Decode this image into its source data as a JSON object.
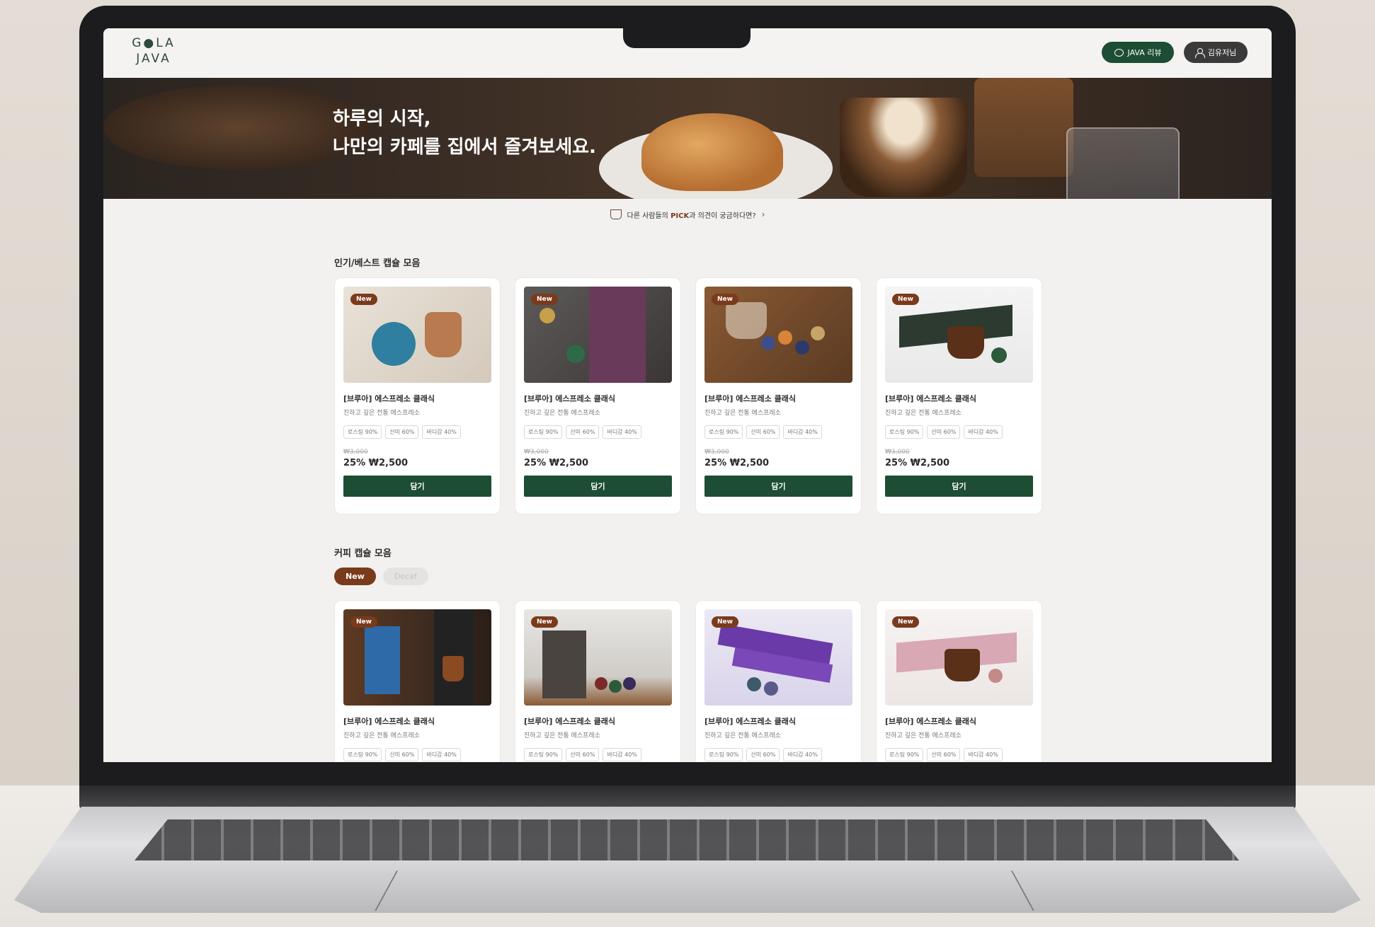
{
  "header": {
    "logo_line1": "G●LA",
    "logo_line2": "JAVA",
    "review_button": "JAVA 리뷰",
    "user_button": "김유저님"
  },
  "hero": {
    "line1": "하루의 시작,",
    "line2": "나만의 카페를 집에서 즐겨보세요."
  },
  "notice": {
    "prefix": "다른 사람들의 ",
    "highlight": "PICK",
    "suffix": "과 의견이 궁금하다면?",
    "chevron": "›"
  },
  "sections": {
    "best_title": "인기/베스트 캡슐 모음",
    "coffee_title": "커피 캡슐 모음",
    "filter_active": "New",
    "filter_inactive": "Decaf"
  },
  "badge": "New",
  "best_products": [
    {
      "name": "[브루아] 에스프레소 클래식",
      "desc": "진하고 깊은 전통 에스프레소",
      "tags": [
        "로스팅 90%",
        "산미 60%",
        "바디감 40%"
      ],
      "old_price": "₩3,000",
      "price": "25% ₩2,500",
      "cart": "담기"
    },
    {
      "name": "[브루아] 에스프레소 클래식",
      "desc": "진하고 깊은 전통 에스프레소",
      "tags": [
        "로스팅 90%",
        "산미 60%",
        "바디감 40%"
      ],
      "old_price": "₩3,000",
      "price": "25% ₩2,500",
      "cart": "담기"
    },
    {
      "name": "[브루아] 에스프레소 클래식",
      "desc": "진하고 깊은 전통 에스프레소",
      "tags": [
        "로스팅 90%",
        "산미 60%",
        "바디감 40%"
      ],
      "old_price": "₩3,000",
      "price": "25% ₩2,500",
      "cart": "담기"
    },
    {
      "name": "[브루아] 에스프레소 클래식",
      "desc": "진하고 깊은 전통 에스프레소",
      "tags": [
        "로스팅 90%",
        "산미 60%",
        "바디감 40%"
      ],
      "old_price": "₩3,000",
      "price": "25% ₩2,500",
      "cart": "담기"
    }
  ],
  "coffee_products": [
    {
      "name": "[브루아] 에스프레소 클래식",
      "desc": "진하고 깊은 전통 에스프레소",
      "tags": [
        "로스팅 90%",
        "산미 60%",
        "바디감 40%"
      ]
    },
    {
      "name": "[브루아] 에스프레소 클래식",
      "desc": "진하고 깊은 전통 에스프레소",
      "tags": [
        "로스팅 90%",
        "산미 60%",
        "바디감 40%"
      ]
    },
    {
      "name": "[브루아] 에스프레소 클래식",
      "desc": "진하고 깊은 전통 에스프레소",
      "tags": [
        "로스팅 90%",
        "산미 60%",
        "바디감 40%"
      ]
    },
    {
      "name": "[브루아] 에스프레소 클래식",
      "desc": "진하고 깊은 전통 에스프레소",
      "tags": [
        "로스팅 90%",
        "산미 60%",
        "바디감 40%"
      ]
    }
  ],
  "colors": {
    "brand_green": "#1d4d33",
    "accent_brown": "#7a3a1c",
    "page_bg": "#f2f1ef"
  }
}
